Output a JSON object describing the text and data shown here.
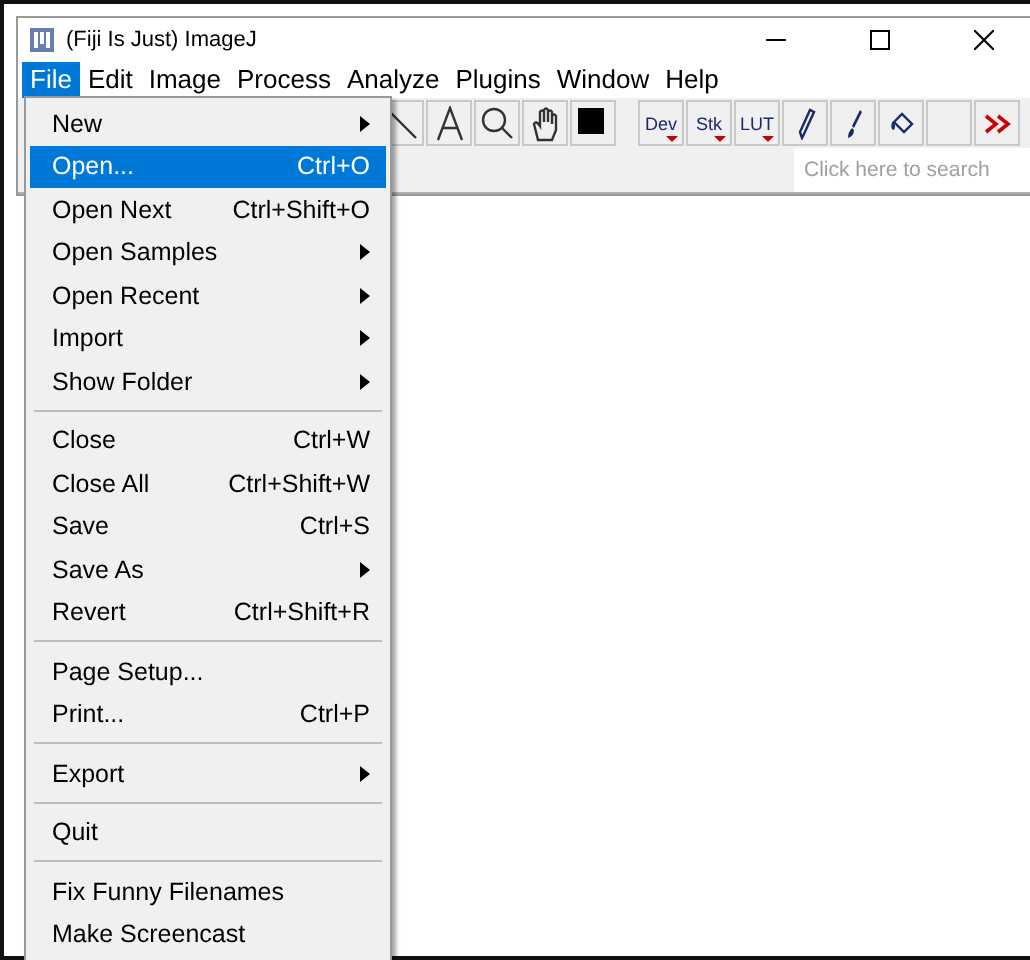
{
  "window": {
    "title": "(Fiji Is Just) ImageJ"
  },
  "menu_bar": [
    {
      "label": "File",
      "selected": true
    },
    {
      "label": "Edit",
      "selected": false
    },
    {
      "label": "Image",
      "selected": false
    },
    {
      "label": "Process",
      "selected": false
    },
    {
      "label": "Analyze",
      "selected": false
    },
    {
      "label": "Plugins",
      "selected": false
    },
    {
      "label": "Window",
      "selected": false
    },
    {
      "label": "Help",
      "selected": false
    }
  ],
  "toolbar": [
    {
      "kind": "line"
    },
    {
      "kind": "text"
    },
    {
      "kind": "zoom"
    },
    {
      "kind": "hand"
    },
    {
      "kind": "color"
    },
    {
      "kind": "gap"
    },
    {
      "kind": "menu",
      "label": "Dev"
    },
    {
      "kind": "menu",
      "label": "Stk"
    },
    {
      "kind": "menu",
      "label": "LUT"
    },
    {
      "kind": "pencil"
    },
    {
      "kind": "brush"
    },
    {
      "kind": "bucket"
    },
    {
      "kind": "blank"
    },
    {
      "kind": "more"
    }
  ],
  "search": {
    "placeholder": "Click here to search"
  },
  "file_menu": [
    {
      "kind": "item",
      "label": "New",
      "submenu": true,
      "selected": false
    },
    {
      "kind": "item",
      "label": "Open...",
      "shortcut": "Ctrl+O",
      "selected": true
    },
    {
      "kind": "item",
      "label": "Open Next",
      "shortcut": "Ctrl+Shift+O",
      "selected": false
    },
    {
      "kind": "item",
      "label": "Open Samples",
      "submenu": true,
      "selected": false
    },
    {
      "kind": "item",
      "label": "Open Recent",
      "submenu": true,
      "selected": false
    },
    {
      "kind": "item",
      "label": "Import",
      "submenu": true,
      "selected": false
    },
    {
      "kind": "item",
      "label": "Show Folder",
      "submenu": true,
      "selected": false
    },
    {
      "kind": "separator"
    },
    {
      "kind": "item",
      "label": "Close",
      "shortcut": "Ctrl+W",
      "selected": false
    },
    {
      "kind": "item",
      "label": "Close All",
      "shortcut": "Ctrl+Shift+W",
      "selected": false
    },
    {
      "kind": "item",
      "label": "Save",
      "shortcut": "Ctrl+S",
      "selected": false
    },
    {
      "kind": "item",
      "label": "Save As",
      "submenu": true,
      "selected": false
    },
    {
      "kind": "item",
      "label": "Revert",
      "shortcut": "Ctrl+Shift+R",
      "selected": false
    },
    {
      "kind": "separator"
    },
    {
      "kind": "item",
      "label": "Page Setup...",
      "selected": false
    },
    {
      "kind": "item",
      "label": "Print...",
      "shortcut": "Ctrl+P",
      "selected": false
    },
    {
      "kind": "separator"
    },
    {
      "kind": "item",
      "label": "Export",
      "submenu": true,
      "selected": false
    },
    {
      "kind": "separator"
    },
    {
      "kind": "item",
      "label": "Quit",
      "selected": false
    },
    {
      "kind": "separator"
    },
    {
      "kind": "item",
      "label": "Fix Funny Filenames",
      "selected": false
    },
    {
      "kind": "item",
      "label": "Make Screencast",
      "selected": false
    }
  ]
}
